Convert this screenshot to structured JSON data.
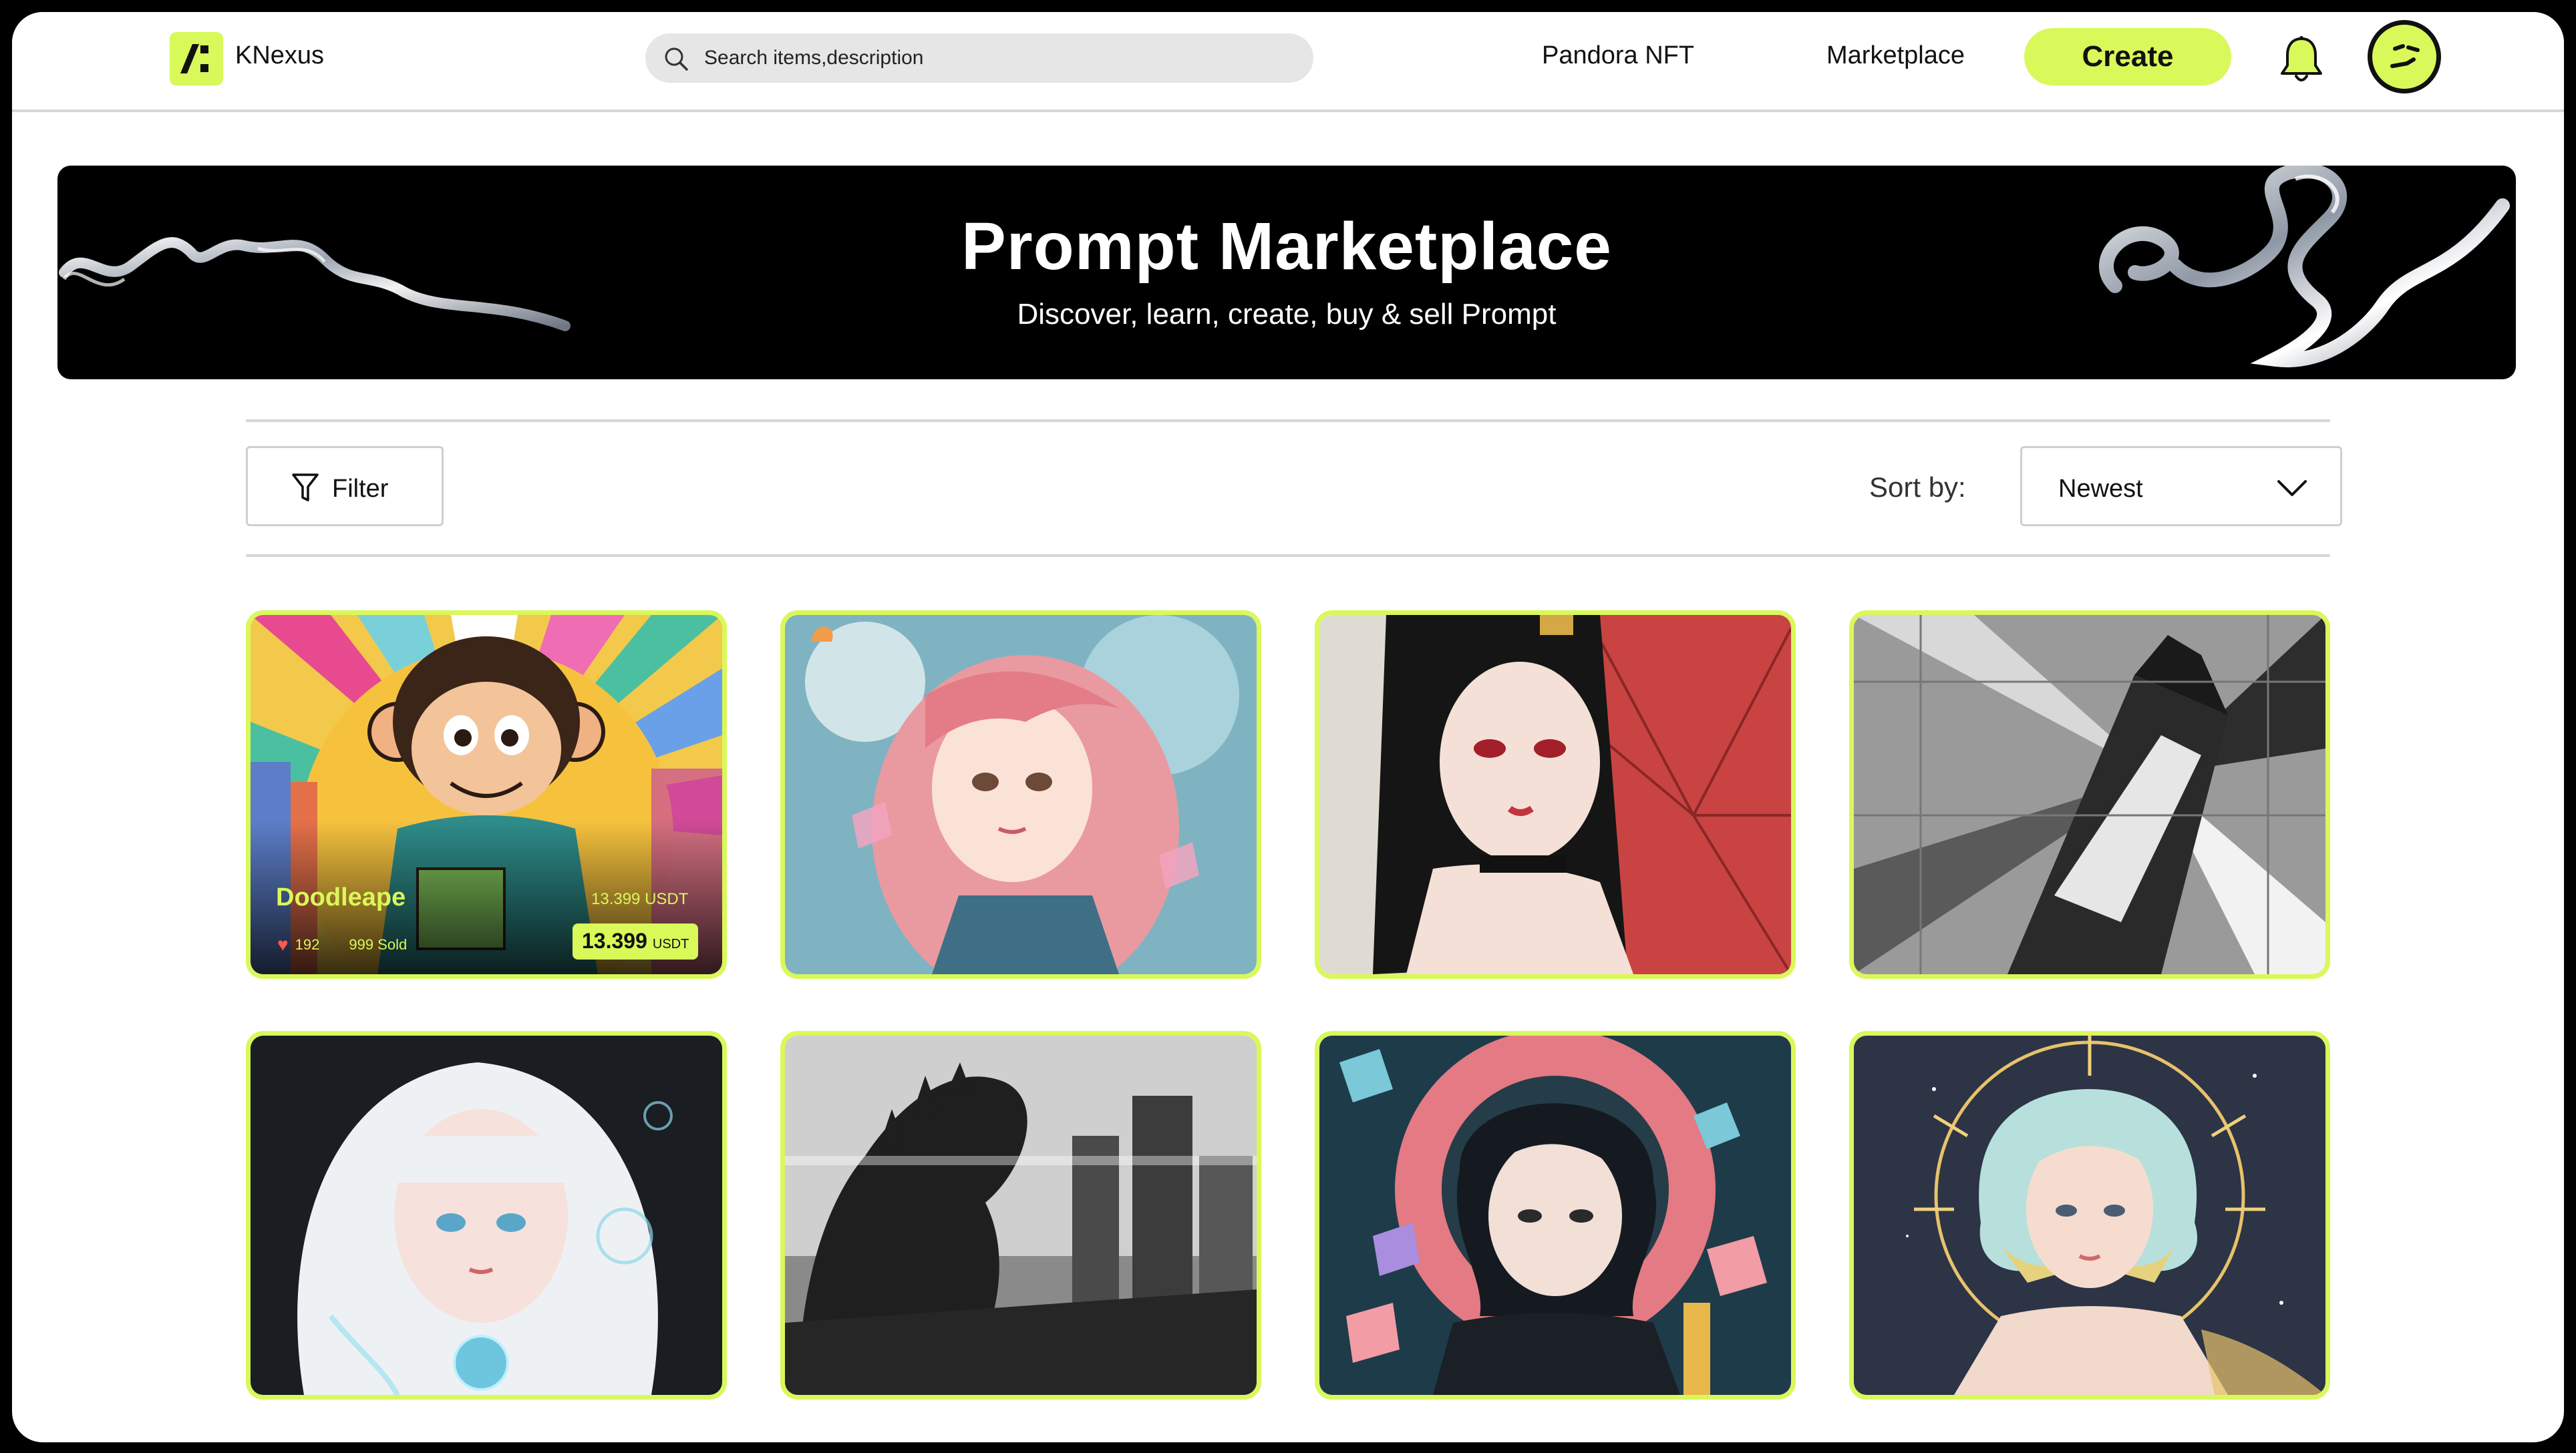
{
  "app": {
    "name": "KNexus"
  },
  "header": {
    "search_placeholder": "Search items,description",
    "nav": [
      {
        "label": "Pandora NFT"
      },
      {
        "label": "Marketplace"
      }
    ],
    "create_label": "Create"
  },
  "banner": {
    "title": "Prompt Marketplace",
    "subtitle": "Discover, learn, create, buy & sell Prompt"
  },
  "toolbar": {
    "filter_label": "Filter",
    "sort_label": "Sort by:",
    "sort_value": "Newest"
  },
  "featured_card": {
    "name": "Doodleape",
    "price_small": "13.399 USDT",
    "likes": "192",
    "sold": "999 Sold",
    "price_value": "13.399",
    "price_currency": "USDT"
  },
  "colors": {
    "accent": "#d9f85a",
    "heart": "#ff5a4a",
    "banner_bg": "#000000"
  }
}
